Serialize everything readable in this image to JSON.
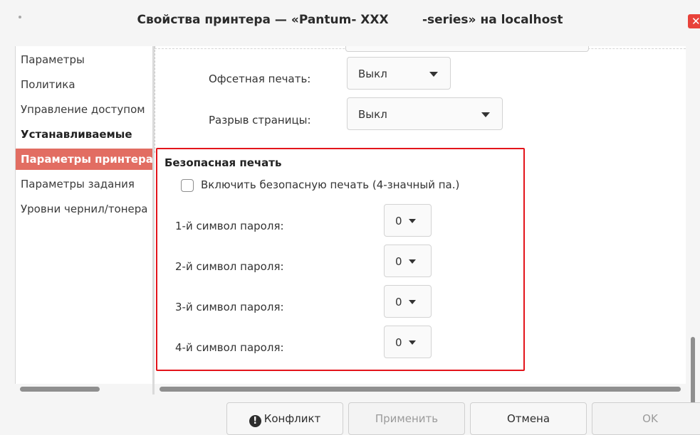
{
  "window": {
    "title": "Свойства принтера — «Pantum- XXX        -series» на localhost",
    "close_glyph": "✕"
  },
  "sidebar": {
    "items": [
      {
        "label": "Параметры"
      },
      {
        "label": "Политика"
      },
      {
        "label": "Управление доступом"
      },
      {
        "label": "Устанавливаемые"
      },
      {
        "label": "Параметры принтера"
      },
      {
        "label": "Параметры задания"
      },
      {
        "label": "Уровни чернил/тонера"
      }
    ],
    "selected_index": 4
  },
  "options": {
    "offset_label": "Офсетная печать:",
    "offset_value": "Выкл",
    "pagebreak_label": "Разрыв страницы:",
    "pagebreak_value": "Выкл"
  },
  "secure_print": {
    "title": "Безопасная печать",
    "enable_label": "Включить безопасную печать (4-значный па.)",
    "enable_checked": false,
    "password_chars": [
      {
        "label": "1-й символ пароля:",
        "value": "0"
      },
      {
        "label": "2-й символ пароля:",
        "value": "0"
      },
      {
        "label": "3-й символ пароля:",
        "value": "0"
      },
      {
        "label": "4-й символ пароля:",
        "value": "0"
      }
    ]
  },
  "buttons": {
    "conflict": "Конфликт",
    "conflict_icon": "!",
    "apply": "Применить",
    "cancel": "Отмена",
    "ok": "OK"
  },
  "colors": {
    "selection": "#e26d62",
    "highlight_frame": "#e3141b",
    "close_button": "#e8423a"
  },
  "icons": [
    "close-icon",
    "conflict-icon",
    "chevron-down-icon"
  ]
}
